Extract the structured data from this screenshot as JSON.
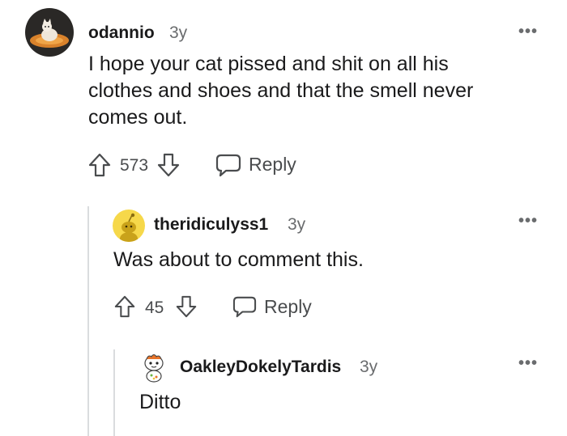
{
  "comments": [
    {
      "username": "odannio",
      "age": "3y",
      "body_lines": [
        "I hope your cat pissed and shit on all his",
        "clothes and shoes and that the smell never",
        "comes out."
      ],
      "votes": "573",
      "reply_label": "Reply",
      "avatar_icon": "cat-avatar-icon"
    },
    {
      "username": "theridiculyss1",
      "age": "3y",
      "body_lines": [
        "Was about to comment this."
      ],
      "votes": "45",
      "reply_label": "Reply",
      "avatar_icon": "snoo-avatar-icon"
    },
    {
      "username": "OakleyDokelyTardis",
      "age": "3y",
      "body_lines": [
        "Ditto"
      ],
      "avatar_icon": "snoo-avatar-icon"
    }
  ],
  "icons": {
    "upvote": "arrow-up-icon",
    "downvote": "arrow-down-icon",
    "reply": "speech-bubble-icon",
    "more": "ellipsis-icon"
  },
  "more_label": "•••",
  "colors": {
    "text": "#1a1a1b",
    "meta": "#6a6c6e",
    "action": "#4a4c4e",
    "thread_line": "#dadcde",
    "avatar2_bg": "#f6d84a"
  }
}
